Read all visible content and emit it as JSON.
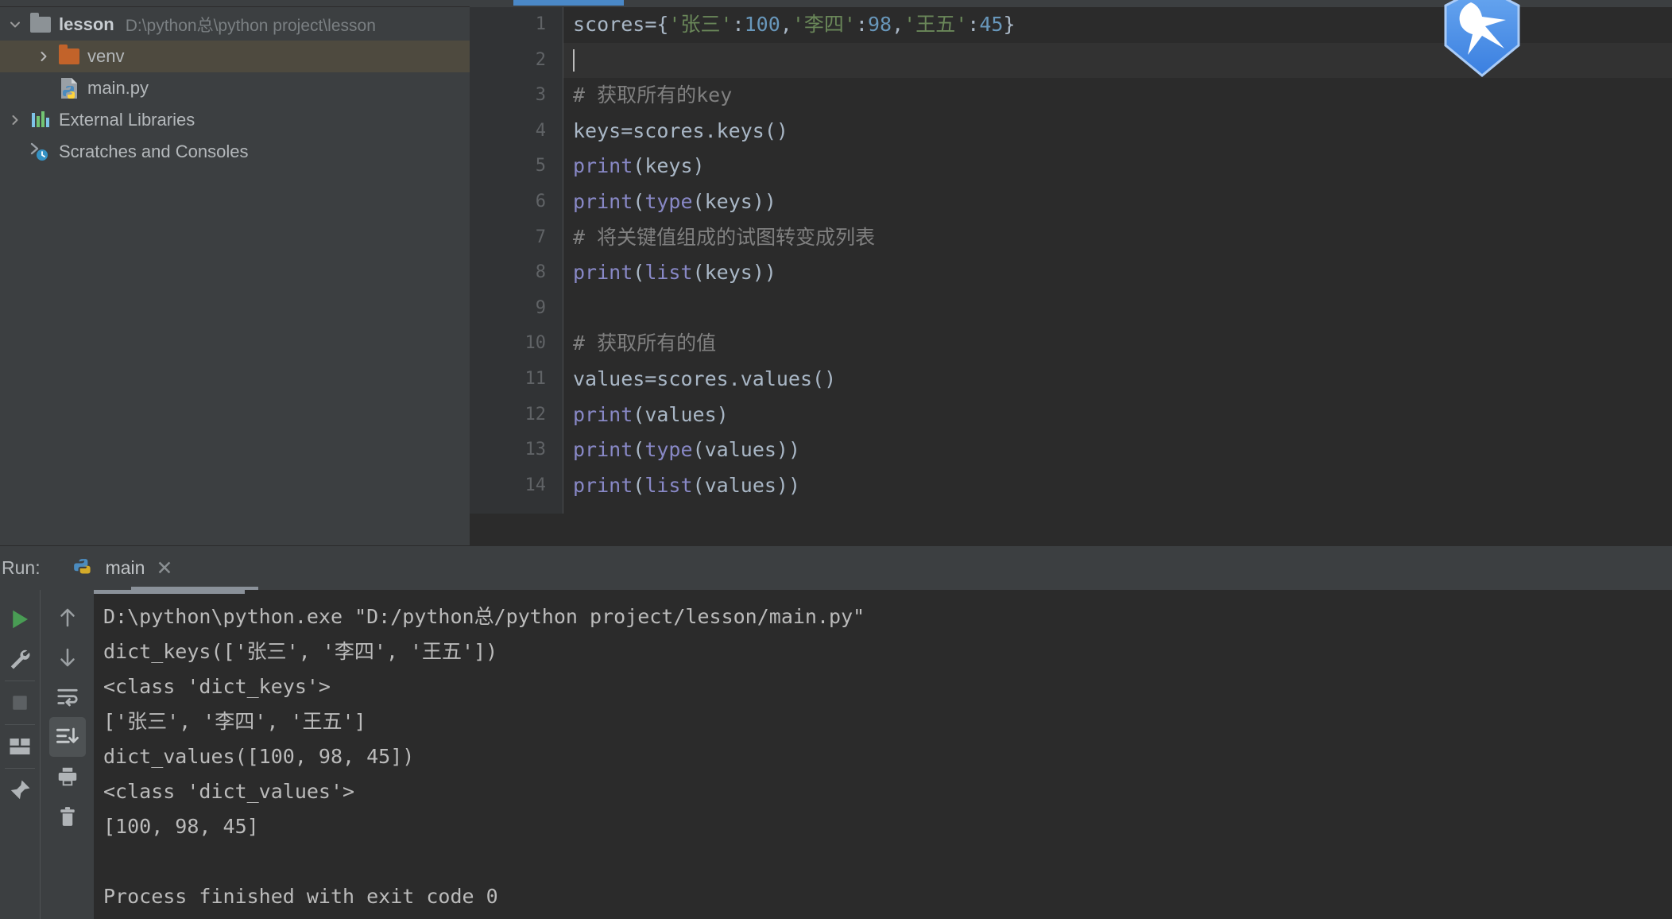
{
  "project": {
    "root": {
      "name": "lesson",
      "path": "D:\\python总\\python project\\lesson",
      "icon": "folder-icon",
      "expanded": true
    },
    "items": [
      {
        "label": "venv",
        "icon": "folder-orange-icon",
        "indent": 2,
        "expandable": true,
        "selected": true
      },
      {
        "label": "main.py",
        "icon": "python-file-icon",
        "indent": 2,
        "expandable": false,
        "selected": false
      },
      {
        "label": "External Libraries",
        "icon": "libraries-icon",
        "indent": 1,
        "expandable": true,
        "selected": false
      },
      {
        "label": "Scratches and Consoles",
        "icon": "scratches-icon",
        "indent": 1,
        "expandable": false,
        "selected": false
      }
    ]
  },
  "editor": {
    "active_tab": "main.py",
    "cursor_line": 2,
    "lines": [
      {
        "n": "1",
        "text": "scores={'张三':100,'李四':98,'王五':45}"
      },
      {
        "n": "2",
        "text": ""
      },
      {
        "n": "3",
        "text": "# 获取所有的key"
      },
      {
        "n": "4",
        "text": "keys=scores.keys()"
      },
      {
        "n": "5",
        "text": "print(keys)"
      },
      {
        "n": "6",
        "text": "print(type(keys))"
      },
      {
        "n": "7",
        "text": "# 将关键值组成的试图转变成列表"
      },
      {
        "n": "8",
        "text": "print(list(keys))"
      },
      {
        "n": "9",
        "text": ""
      },
      {
        "n": "10",
        "text": "# 获取所有的值"
      },
      {
        "n": "11",
        "text": "values=scores.values()"
      },
      {
        "n": "12",
        "text": "print(values)"
      },
      {
        "n": "13",
        "text": "print(type(values))"
      },
      {
        "n": "14",
        "text": "print(list(values))"
      }
    ]
  },
  "run": {
    "label": "Run:",
    "tab_label": "main",
    "close_label": "✕",
    "toolbar_left": [
      {
        "name": "rerun-button",
        "icon": "play-icon"
      },
      {
        "name": "run-configurations-button",
        "icon": "wrench-icon"
      },
      {
        "name": "stop-button",
        "icon": "stop-icon"
      },
      {
        "name": "layout-button",
        "icon": "layout-icon"
      },
      {
        "name": "pin-tab-button",
        "icon": "pin-icon"
      }
    ],
    "toolbar_right": [
      {
        "name": "up-the-stack-trace-button",
        "icon": "arrow-up-icon"
      },
      {
        "name": "down-the-stack-trace-button",
        "icon": "arrow-down-icon"
      },
      {
        "name": "soft-wrap-button",
        "icon": "soft-wrap-icon"
      },
      {
        "name": "scroll-to-end-button",
        "icon": "scroll-to-end-icon",
        "active": true
      },
      {
        "name": "print-button",
        "icon": "printer-icon"
      },
      {
        "name": "clear-all-button",
        "icon": "trash-icon"
      }
    ],
    "console_lines": [
      "D:\\python\\python.exe \"D:/python总/python project/lesson/main.py\"",
      "dict_keys(['张三', '李四', '王五'])",
      "<class 'dict_keys'>",
      "['张三', '李四', '王五']",
      "dict_values([100, 98, 45])",
      "<class 'dict_values'>",
      "[100, 98, 45]",
      "",
      "Process finished with exit code 0"
    ]
  },
  "colors": {
    "accent_tab": "#4a88c7",
    "selection": "#4e4a3f",
    "editor_bg": "#2b2b2b",
    "panel_bg": "#3c3f41",
    "string": "#6a8759",
    "number": "#6897bb",
    "function": "#8888c6",
    "comment": "#808080",
    "text": "#a9b7c6",
    "folder_orange": "#c2632a",
    "run_green": "#499c54"
  }
}
